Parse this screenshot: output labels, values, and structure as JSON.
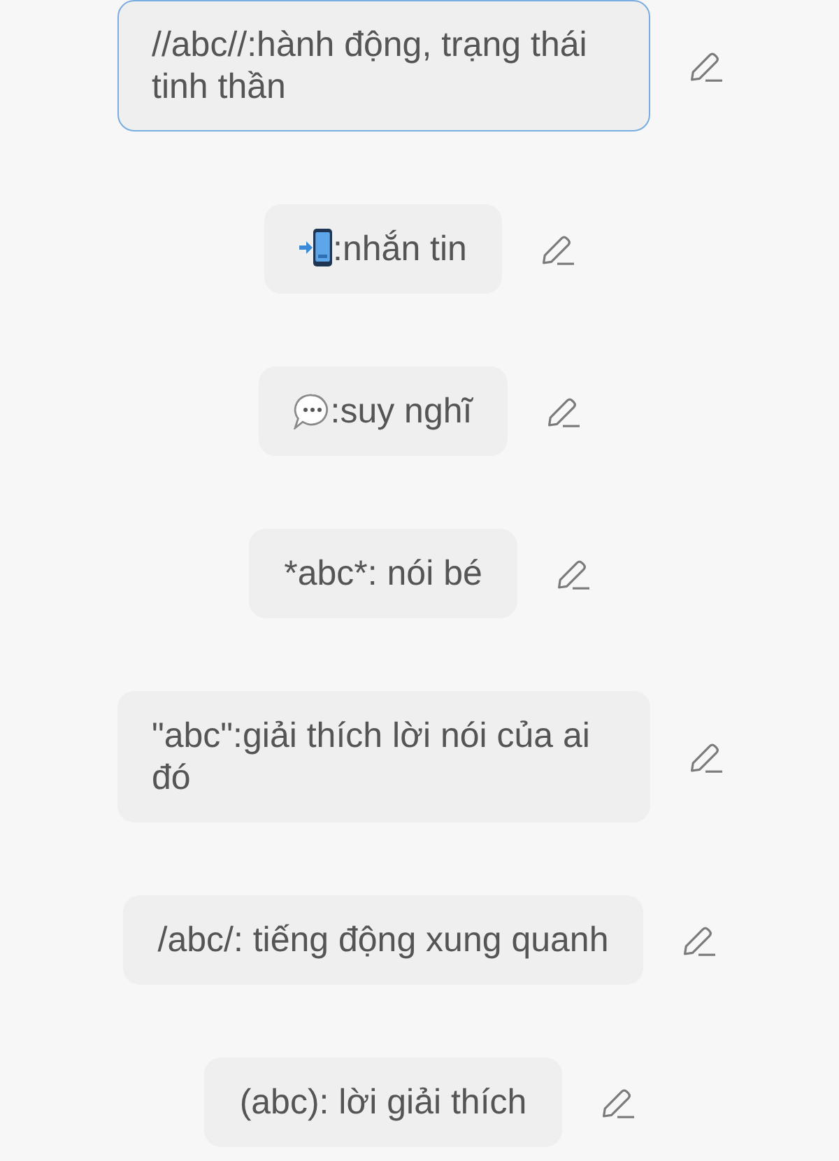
{
  "messages": [
    {
      "kind": "plain",
      "text": "//abc//:hành động, trạng thái tinh thần",
      "selected": true
    },
    {
      "kind": "phone",
      "text": ":nhắn tin",
      "selected": false
    },
    {
      "kind": "speech",
      "text": ":suy nghĩ",
      "selected": false
    },
    {
      "kind": "plain",
      "text": "*abc*: nói bé",
      "selected": false
    },
    {
      "kind": "plain",
      "text": "\"abc\":giải thích lời nói của ai đó",
      "selected": false
    },
    {
      "kind": "plain",
      "text": "/abc/: tiếng động xung quanh",
      "selected": false
    },
    {
      "kind": "plain",
      "text": "(abc): lời giải thích",
      "selected": false
    }
  ]
}
